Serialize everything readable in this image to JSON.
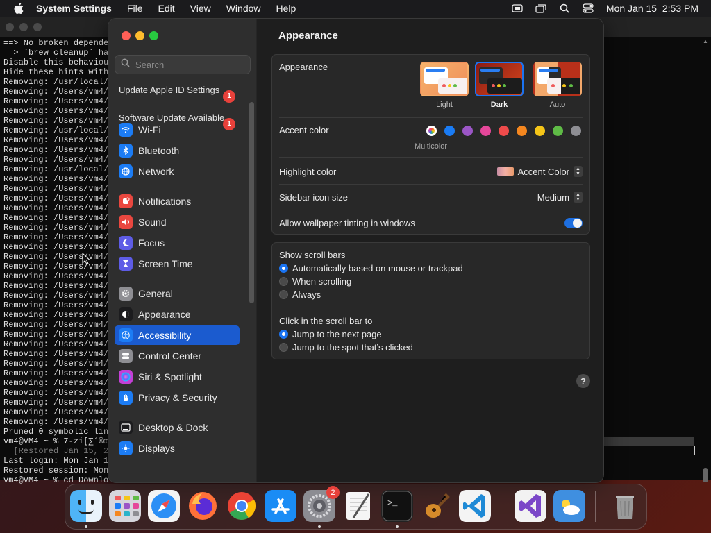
{
  "menubar": {
    "app_name": "System Settings",
    "menus": [
      "File",
      "Edit",
      "View",
      "Window",
      "Help"
    ],
    "clock": "Mon Jan 15  2:53 PM",
    "status_icons": [
      "screen-recording-icon",
      "display-mirror-icon",
      "spotlight-search-icon",
      "control-center-icon"
    ]
  },
  "terminal": {
    "lines": [
      "==> No broken depende",
      "==> `brew cleanup` ha",
      "Disable this behaviou",
      "Hide these hints with",
      "Removing: /usr/local/",
      "Removing: /Users/vm4/",
      "Removing: /Users/vm4/",
      "Removing: /Users/vm4/",
      "Removing: /Users/vm4/",
      "Removing: /usr/local/",
      "Removing: /Users/vm4/",
      "Removing: /Users/vm4/",
      "Removing: /Users/vm4/",
      "Removing: /usr/local/",
      "Removing: /Users/vm4/",
      "Removing: /Users/vm4/",
      "Removing: /Users/vm4/",
      "Removing: /Users/vm4/",
      "Removing: /Users/vm4/",
      "Removing: /Users/vm4/",
      "Removing: /Users/vm4/",
      "Removing: /Users/vm4/",
      "Removing: /Users/vm4/",
      "Removing: /Users/vm4/",
      "Removing: /Users/vm4/",
      "Removing: /Users/vm4/",
      "Removing: /Users/vm4/",
      "Removing: /Users/vm4/",
      "Removing: /Users/vm4/",
      "Removing: /Users/vm4/",
      "Removing: /Users/vm4/",
      "Removing: /Users/vm4/",
      "Removing: /Users/vm4/",
      "Removing: /Users/vm4/",
      "Removing: /Users/vm4/",
      "Removing: /Users/vm4/",
      "Removing: /Users/vm4/",
      "Removing: /Users/vm4/",
      "Removing: /Users/vm4/",
      "Removing: /Users/vm4/",
      "Pruned 0 symbolic lin",
      "vm4@VM4 ~ % 7-zi[∑´®œ",
      "  [Restored Jan 15, 2",
      "Last login: Mon Jan 1",
      "Restored session: Mon",
      "vm4@VM4 ~ % cd Downlo"
    ]
  },
  "settings": {
    "search_placeholder": "Search",
    "notices": [
      {
        "label": "Update Apple ID Settings",
        "badge": "1"
      },
      {
        "label": "Software Update Available",
        "badge": "1"
      }
    ],
    "sidebar": [
      {
        "label": "Wi-Fi",
        "icon": "wifi-icon",
        "color": "#1c7cf4"
      },
      {
        "label": "Bluetooth",
        "icon": "bluetooth-icon",
        "color": "#1c7cf4"
      },
      {
        "label": "Network",
        "icon": "globe-icon",
        "color": "#1c7cf4"
      },
      {
        "label": "Notifications",
        "icon": "bell-icon",
        "color": "#e9473f"
      },
      {
        "label": "Sound",
        "icon": "speaker-icon",
        "color": "#e9473f"
      },
      {
        "label": "Focus",
        "icon": "moon-icon",
        "color": "#5e5ce6"
      },
      {
        "label": "Screen Time",
        "icon": "hourglass-icon",
        "color": "#5e5ce6"
      },
      {
        "label": "General",
        "icon": "gear-icon",
        "color": "#8e8e93"
      },
      {
        "label": "Appearance",
        "icon": "appearance-icon",
        "color": "#1c1c1e"
      },
      {
        "label": "Accessibility",
        "icon": "accessibility-icon",
        "color": "#1c7cf4"
      },
      {
        "label": "Control Center",
        "icon": "toggles-icon",
        "color": "#8e8e93"
      },
      {
        "label": "Siri & Spotlight",
        "icon": "siri-icon",
        "color": "#c43fd6"
      },
      {
        "label": "Privacy & Security",
        "icon": "hand-icon",
        "color": "#1c7cf4"
      },
      {
        "label": "Desktop & Dock",
        "icon": "dock-icon",
        "color": "#1c1c1e"
      },
      {
        "label": "Displays",
        "icon": "sun-icon",
        "color": "#1c7cf4"
      }
    ],
    "selected_sidebar": "Accessibility",
    "page_title": "Appearance",
    "appearance": {
      "label": "Appearance",
      "options": [
        "Light",
        "Dark",
        "Auto"
      ],
      "selected": "Dark"
    },
    "accent": {
      "label": "Accent color",
      "colors": [
        "multicolor",
        "#1a7cf5",
        "#9b56c6",
        "#e5479a",
        "#ef4b4b",
        "#f5871f",
        "#f5c518",
        "#5fbb46",
        "#8e8e93"
      ],
      "selected_name": "Multicolor"
    },
    "highlight": {
      "label": "Highlight color",
      "value": "Accent Color"
    },
    "sidebar_icon_size": {
      "label": "Sidebar icon size",
      "value": "Medium"
    },
    "wallpaper_tinting": {
      "label": "Allow wallpaper tinting in windows",
      "enabled": true
    },
    "scroll_bars": {
      "label": "Show scroll bars",
      "options": [
        "Automatically based on mouse or trackpad",
        "When scrolling",
        "Always"
      ],
      "selected": 0
    },
    "click_scroll": {
      "label": "Click in the scroll bar to",
      "options": [
        "Jump to the next page",
        "Jump to the spot that’s clicked"
      ],
      "selected": 0
    },
    "help_label": "?"
  },
  "dock": {
    "apps": [
      {
        "name": "Finder",
        "icon": "finder-icon"
      },
      {
        "name": "Launchpad",
        "icon": "launchpad-icon"
      },
      {
        "name": "Safari",
        "icon": "safari-icon"
      },
      {
        "name": "Firefox",
        "icon": "firefox-icon"
      },
      {
        "name": "Chrome",
        "icon": "chrome-icon"
      },
      {
        "name": "App Store",
        "icon": "appstore-icon"
      },
      {
        "name": "System Settings",
        "icon": "settings-icon",
        "badge": "2"
      },
      {
        "name": "TextEdit",
        "icon": "textedit-icon"
      },
      {
        "name": "Terminal",
        "icon": "terminal-icon"
      },
      {
        "name": "GarageBand",
        "icon": "guitar-icon"
      },
      {
        "name": "Visual Studio Code",
        "icon": "vscode-icon"
      },
      {
        "name": "Visual Studio",
        "icon": "visualstudio-icon"
      },
      {
        "name": "Weather",
        "icon": "weather-icon"
      },
      {
        "name": "Trash",
        "icon": "trash-icon"
      }
    ]
  }
}
